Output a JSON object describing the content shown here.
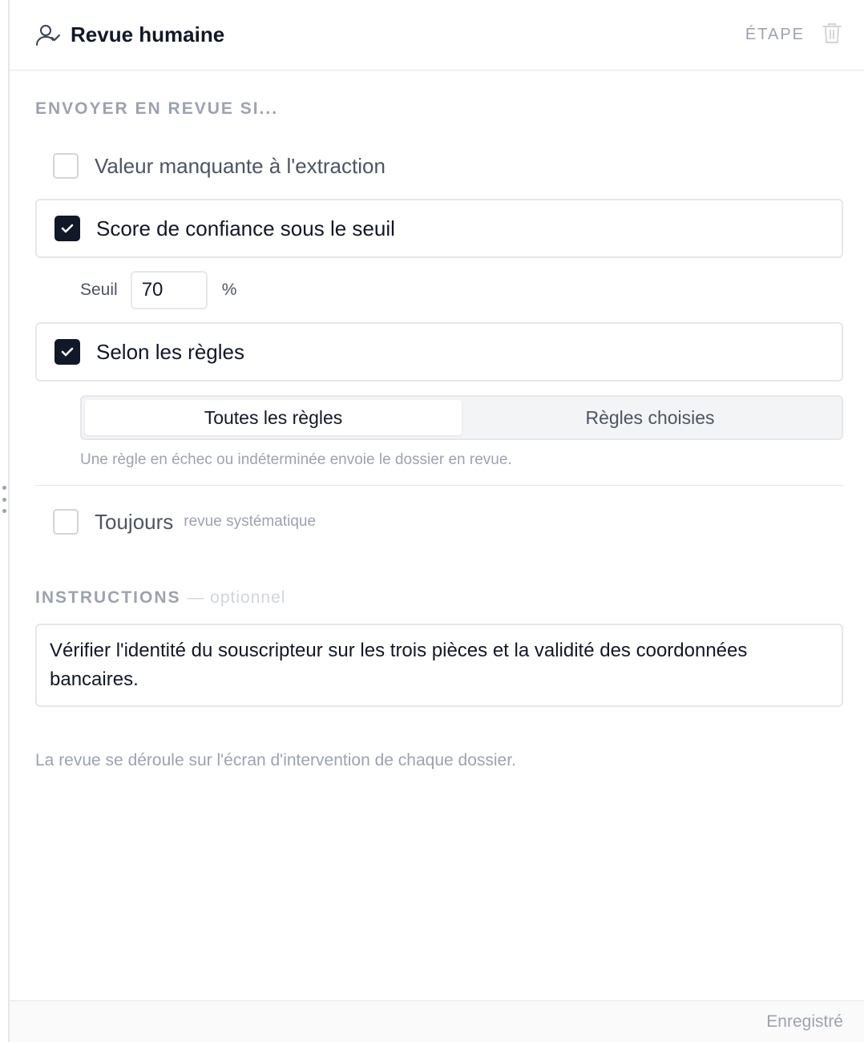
{
  "header": {
    "title": "Revue humaine",
    "step_label": "ÉTAPE",
    "icon": "user-check-icon",
    "delete_icon": "trash-icon"
  },
  "review_conditions": {
    "section_label": "ENVOYER EN REVUE SI...",
    "options": [
      {
        "label": "Valeur manquante à l'extraction",
        "checked": false
      },
      {
        "label": "Score de confiance sous le seuil",
        "checked": true
      },
      {
        "label": "Selon les règles",
        "checked": true
      },
      {
        "label": "Toujours",
        "sublabel": "revue systématique",
        "checked": false
      }
    ],
    "threshold": {
      "label": "Seuil",
      "value": "70",
      "unit": "%"
    },
    "rules_mode": {
      "options": [
        "Toutes les règles",
        "Règles choisies"
      ],
      "selected": "Toutes les règles",
      "hint": "Une règle en échec ou indéterminée envoie le dossier en revue."
    }
  },
  "instructions": {
    "label": "INSTRUCTIONS",
    "optional_label": "— optionnel",
    "value": "Vérifier l'identité du souscripteur sur les trois pièces et la validité des coordonnées bancaires."
  },
  "footnote": "La revue se déroule sur l'écran d'intervention de chaque dossier.",
  "footer": {
    "status": "Enregistré"
  },
  "colors": {
    "accent": "#111827",
    "border": "#e5e7eb",
    "muted_text": "#9ca3af"
  }
}
